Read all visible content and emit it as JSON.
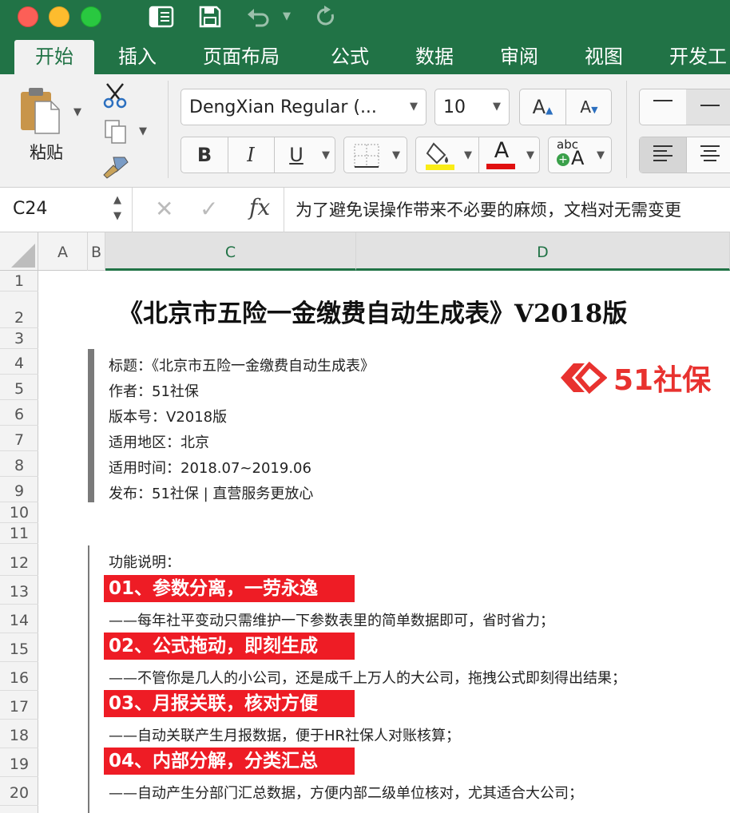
{
  "toolbar": {
    "undo_icon": "undo-icon",
    "redo_icon": "redo-icon"
  },
  "tabs": [
    {
      "label": "开始"
    },
    {
      "label": "插入"
    },
    {
      "label": "页面布局"
    },
    {
      "label": "公式"
    },
    {
      "label": "数据"
    },
    {
      "label": "审阅"
    },
    {
      "label": "视图"
    },
    {
      "label": "开发工"
    }
  ],
  "ribbon": {
    "paste_label": "粘贴",
    "font_name": "DengXian Regular (...",
    "font_size": "10",
    "bold": "B",
    "italic": "I",
    "underline": "U",
    "grow_font": "A",
    "shrink_font": "A",
    "font_color_letter": "A",
    "abc_label": "abc",
    "abc_a": "A"
  },
  "formula_bar": {
    "cell_ref": "C24",
    "fx_label": "fx",
    "formula": "为了避免误操作带来不必要的麻烦，文档对无需变更"
  },
  "columns": [
    "A",
    "B",
    "C",
    "D"
  ],
  "rows": [
    "1",
    "2",
    "3",
    "4",
    "5",
    "6",
    "7",
    "8",
    "9",
    "10",
    "11",
    "12",
    "13",
    "14",
    "15",
    "16",
    "17",
    "18",
    "19",
    "20"
  ],
  "sheet": {
    "title": "《北京市五险一金缴费自动生成表》V2018版",
    "meta": [
      "标题：《北京市五险一金缴费自动生成表》",
      "作者：51社保",
      "版本号：V2018版",
      "适用地区：北京",
      "适用时间：2018.07~2019.06",
      "发布：51社保 | 直营服务更放心"
    ],
    "logo_text": "51社保",
    "func_title": "功能说明：",
    "features": [
      {
        "title": "01、参数分离，一劳永逸",
        "desc": "——每年社平变动只需维护一下参数表里的简单数据即可，省时省力；"
      },
      {
        "title": "02、公式拖动，即刻生成",
        "desc": "——不管你是几人的小公司，还是成千上万人的大公司，拖拽公式即刻得出结果；"
      },
      {
        "title": "03、月报关联，核对方便",
        "desc": "——自动关联产生月报数据，便于HR社保人对账核算；"
      },
      {
        "title": "04、内部分解，分类汇总",
        "desc": "——自动产生分部门汇总数据，方便内部二级单位核对，尤其适合大公司；"
      }
    ]
  },
  "colors": {
    "excel_green": "#217346",
    "feature_red": "#ee1c25",
    "logo_red": "#e8322f"
  }
}
